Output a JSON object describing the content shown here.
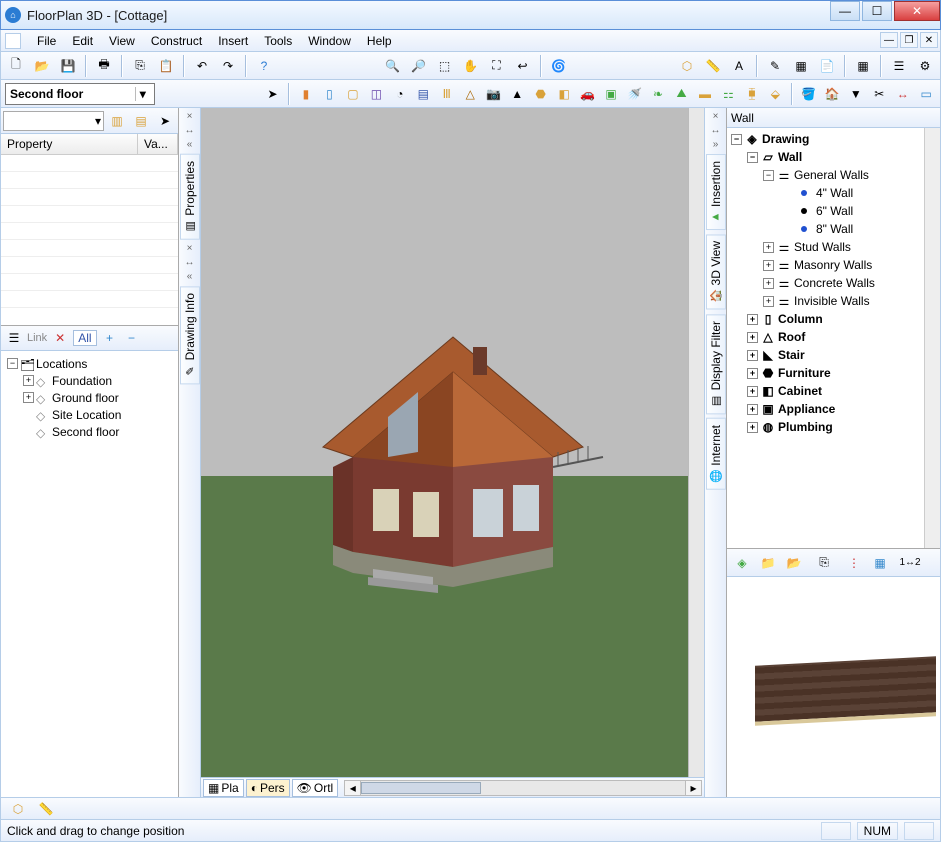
{
  "title": "FloorPlan 3D - [Cottage]",
  "menu": {
    "file": "File",
    "edit": "Edit",
    "view": "View",
    "construct": "Construct",
    "insert": "Insert",
    "tools": "Tools",
    "window": "Window",
    "help": "Help"
  },
  "floor_selector": "Second floor",
  "property_panel": {
    "col_property": "Property",
    "col_value": "Va..."
  },
  "locations_panel": {
    "filter_all": "All",
    "link": "Link",
    "root": "Locations",
    "items": [
      "Foundation",
      "Ground floor",
      "Site Location",
      "Second floor"
    ]
  },
  "side_tabs_left": {
    "properties": "Properties",
    "drawing_info": "Drawing Info"
  },
  "side_tabs_right": {
    "insertion": "Insertion",
    "view3d": "3D View",
    "display_filter": "Display Filter",
    "internet": "Internet"
  },
  "bottom_view_tabs": {
    "plan": "Pla",
    "perspective": "Pers",
    "ortho": "Ortl"
  },
  "right_panel": {
    "label": "Wall",
    "tree": {
      "drawing": "Drawing",
      "wall": "Wall",
      "general_walls": "General Walls",
      "wall4": "4\" Wall",
      "wall6": "6\" Wall",
      "wall8": "8\" Wall",
      "stud_walls": "Stud Walls",
      "masonry_walls": "Masonry Walls",
      "concrete_walls": "Concrete Walls",
      "invisible_walls": "Invisible Walls",
      "column": "Column",
      "roof": "Roof",
      "stair": "Stair",
      "furniture": "Furniture",
      "cabinet": "Cabinet",
      "appliance": "Appliance",
      "plumbing": "Plumbing"
    }
  },
  "statusbar": {
    "hint": "Click and drag to change position",
    "num": "NUM"
  }
}
